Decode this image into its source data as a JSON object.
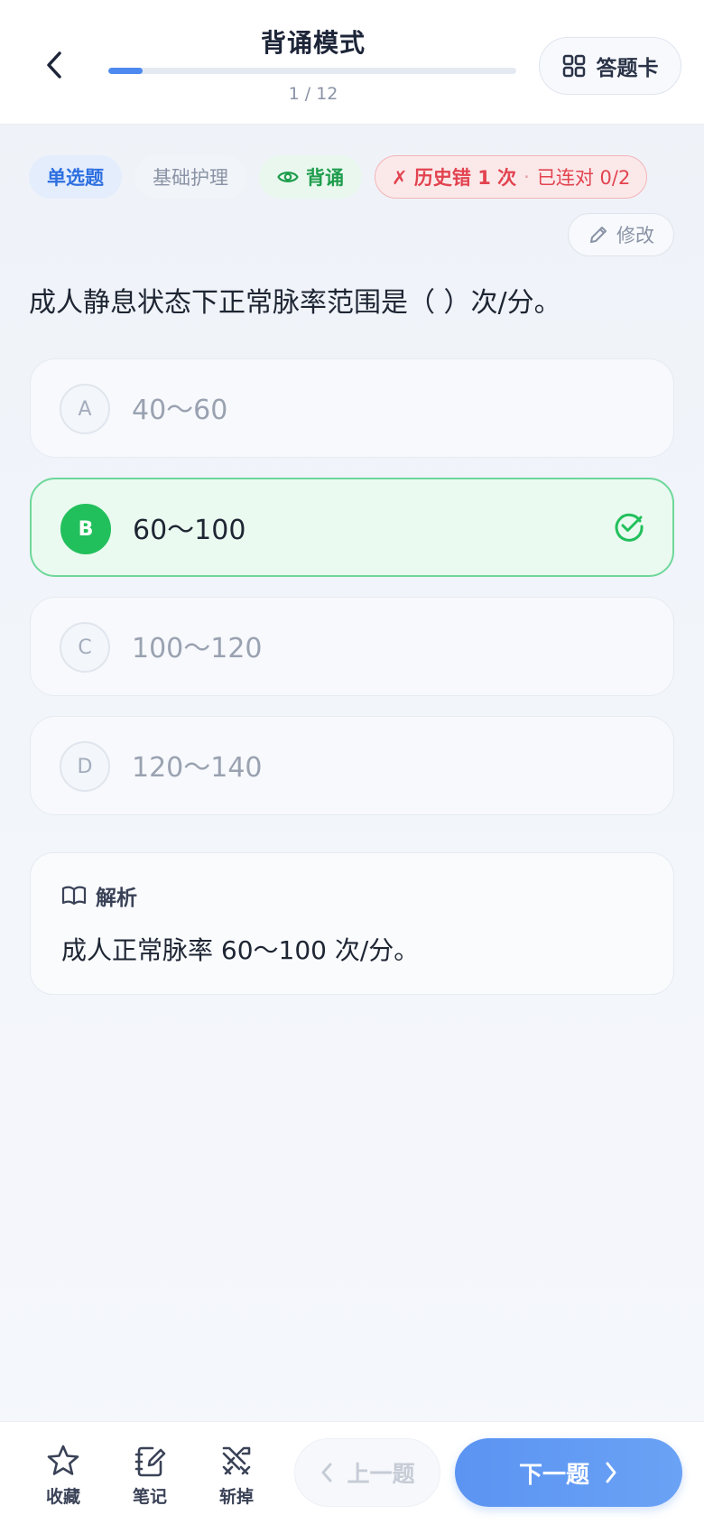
{
  "header": {
    "title": "背诵模式",
    "progress_text": "1 / 12",
    "progress_fraction": 0.0833,
    "card_label": "答题卡"
  },
  "tags": {
    "type": "单选题",
    "category": "基础护理",
    "mode": "背诵",
    "history_wrong": "✗ 历史错 1 次",
    "dot": "·",
    "streak": "已连对 0/2"
  },
  "edit_label": "修改",
  "question": "成人静息状态下正常脉率范围是（ ）次/分。",
  "options": [
    {
      "letter": "A",
      "text": "40～60",
      "correct": false
    },
    {
      "letter": "B",
      "text": "60～100",
      "correct": true
    },
    {
      "letter": "C",
      "text": "100～120",
      "correct": false
    },
    {
      "letter": "D",
      "text": "120～140",
      "correct": false
    }
  ],
  "analysis": {
    "title": "解析",
    "body": "成人正常脉率 60～100 次/分。"
  },
  "bottom": {
    "favorite": "收藏",
    "note": "笔记",
    "remove": "斩掉",
    "prev": "上一题",
    "next": "下一题"
  },
  "colors": {
    "accent": "#4d8af0",
    "correct": "#22c05c",
    "error": "#e2434f"
  }
}
